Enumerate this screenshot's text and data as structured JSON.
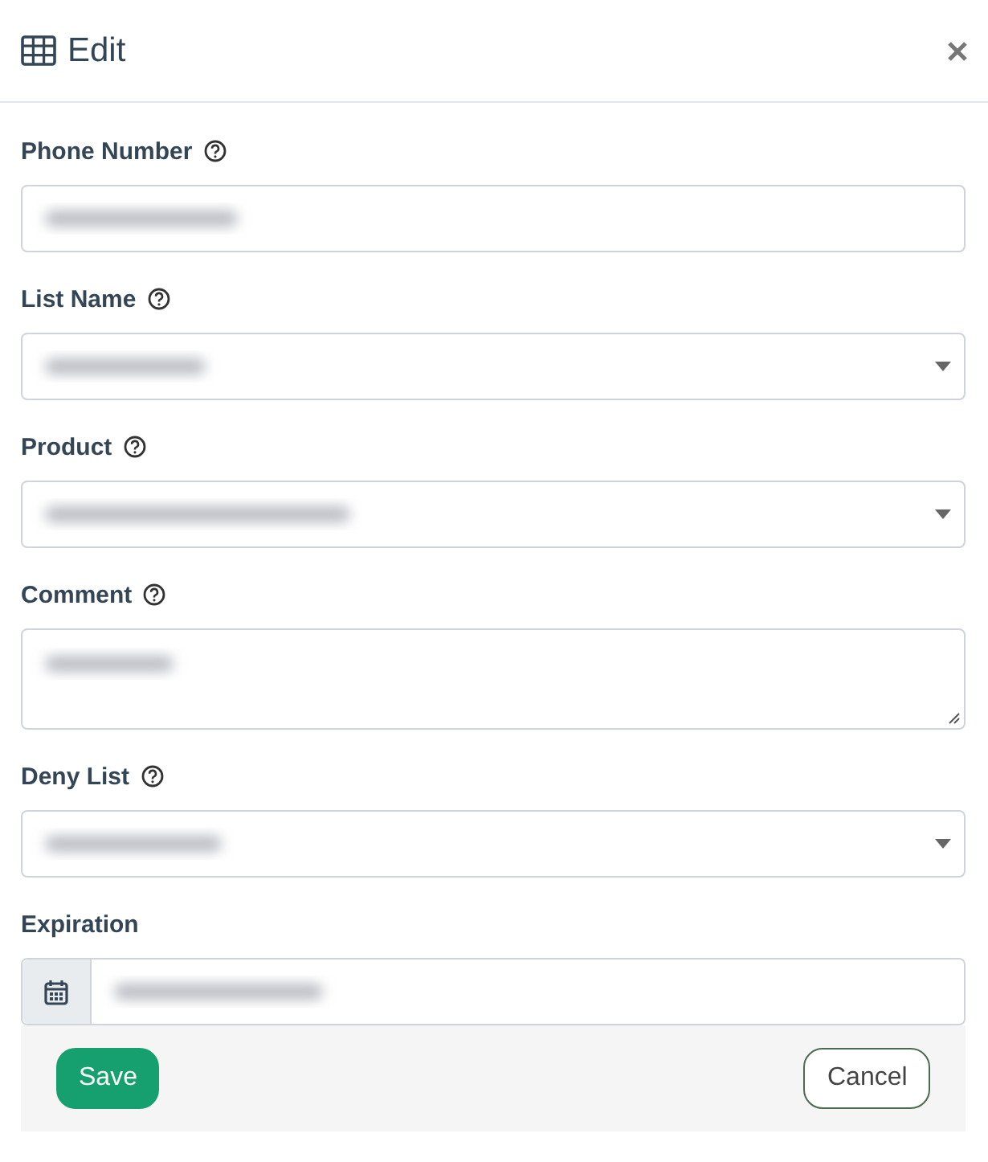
{
  "dialog": {
    "title": "Edit"
  },
  "fields": [
    {
      "label": "Phone Number",
      "help": true,
      "kind": "text"
    },
    {
      "label": "List Name",
      "help": true,
      "kind": "select"
    },
    {
      "label": "Product",
      "help": true,
      "kind": "select"
    },
    {
      "label": "Comment",
      "help": true,
      "kind": "textarea"
    },
    {
      "label": "Deny List",
      "help": true,
      "kind": "select"
    },
    {
      "label": "Expiration",
      "help": false,
      "kind": "date"
    }
  ],
  "buttons": [
    {
      "label": "Save",
      "kind": "primary"
    },
    {
      "label": "Cancel",
      "kind": "secondary"
    }
  ]
}
